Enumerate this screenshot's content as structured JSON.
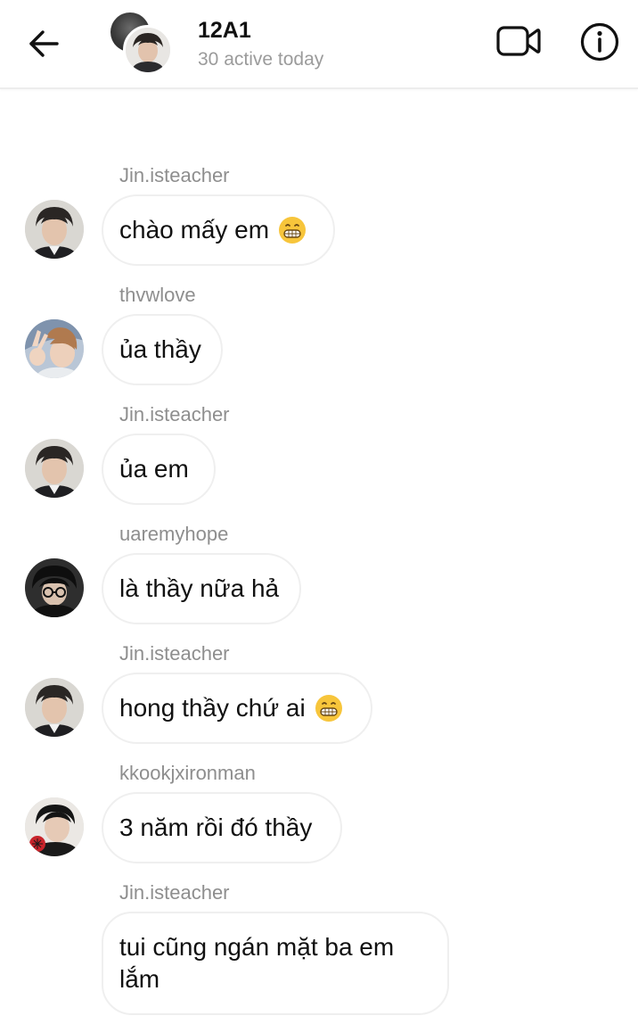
{
  "header": {
    "title": "12A1",
    "subtitle": "30 active today",
    "back_icon": "arrow-left-icon",
    "video_icon": "video-camera-icon",
    "info_icon": "info-icon"
  },
  "messages": [
    {
      "sender": "Jin.isteacher",
      "text": "chào mấy em",
      "emoji": "grinning-face"
    },
    {
      "sender": "thvwlove",
      "text": "ủa thầy",
      "emoji": ""
    },
    {
      "sender": "Jin.isteacher",
      "text": "ủa em",
      "emoji": ""
    },
    {
      "sender": "uaremyhope",
      "text": "là thầy nữa hả",
      "emoji": ""
    },
    {
      "sender": "Jin.isteacher",
      "text": "hong thầy chứ ai",
      "emoji": "grinning-face"
    },
    {
      "sender": "kkookjxironman",
      "text": "3 năm rồi đó thầy",
      "emoji": ""
    },
    {
      "sender": "Jin.isteacher",
      "text": "tui cũng ngán mặt ba em lắm",
      "emoji": ""
    }
  ],
  "colors": {
    "sender_text": "#8e8e8e",
    "bubble_border": "#efefef",
    "subtitle": "#9b9b9b"
  }
}
